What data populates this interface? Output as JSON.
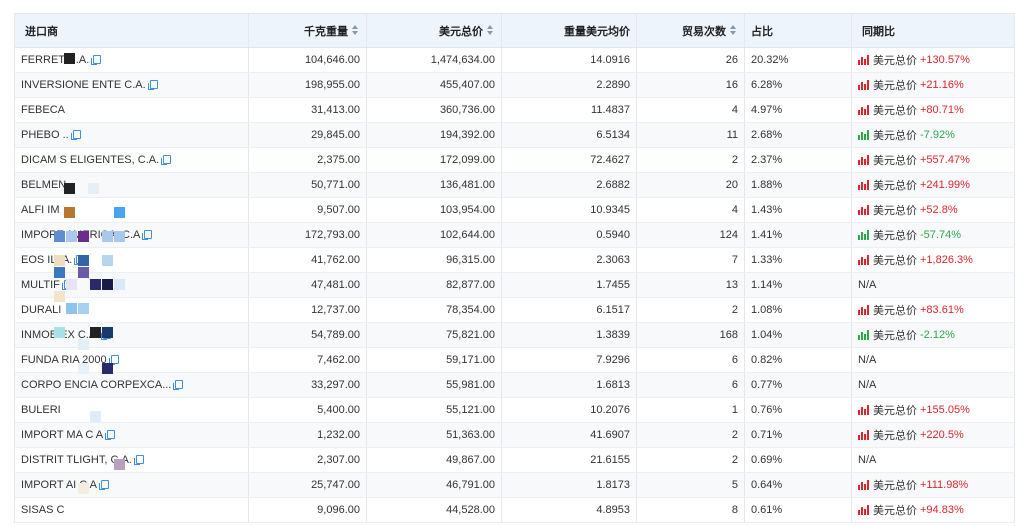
{
  "headers": {
    "importer": "进口商",
    "weight": "千克重量",
    "total_usd": "美元总价",
    "unit_price": "重量美元均价",
    "trades": "贸易次数",
    "share": "占比",
    "yoy": "同期比"
  },
  "colors": {
    "up": "#e0242c",
    "down": "#2ba84a",
    "header_bg": "#eef4fc",
    "copy_icon": "#3d8fe0"
  },
  "rows": [
    {
      "name": "FERRET      C.A.",
      "weight": "104,646.00",
      "total": "1,474,634.00",
      "unit": "14.0916",
      "trades": "26",
      "share": "20.32%",
      "yoy_label": "美元总价",
      "yoy_value": "+130.57%",
      "dir": "up",
      "copy": true
    },
    {
      "name": "INVERSIONE        ENTE C.A.",
      "weight": "198,955.00",
      "total": "455,407.00",
      "unit": "2.2890",
      "trades": "16",
      "share": "6.28%",
      "yoy_label": "美元总价",
      "yoy_value": "+21.16%",
      "dir": "up",
      "copy": true
    },
    {
      "name": "FEBECA",
      "weight": "31,413.00",
      "total": "360,736.00",
      "unit": "11.4837",
      "trades": "4",
      "share": "4.97%",
      "yoy_label": "美元总价",
      "yoy_value": "+80.71%",
      "dir": "up",
      "copy": false
    },
    {
      "name": "PHEBO        ..",
      "weight": "29,845.00",
      "total": "194,392.00",
      "unit": "6.5134",
      "trades": "11",
      "share": "2.68%",
      "yoy_label": "美元总价",
      "yoy_value": "-7.92%",
      "dir": "down",
      "copy": true
    },
    {
      "name": "DICAM S        ELIGENTES, C.A.",
      "weight": "2,375.00",
      "total": "172,099.00",
      "unit": "72.4627",
      "trades": "2",
      "share": "2.37%",
      "yoy_label": "美元总价",
      "yoy_value": "+557.47%",
      "dir": "up",
      "copy": true
    },
    {
      "name": "BELMEN",
      "weight": "50,771.00",
      "total": "136,481.00",
      "unit": "2.6882",
      "trades": "20",
      "share": "1.88%",
      "yoy_label": "美元总价",
      "yoy_value": "+241.99%",
      "dir": "up",
      "copy": false
    },
    {
      "name": "ALFI IM",
      "weight": "9,507.00",
      "total": "103,954.00",
      "unit": "10.9345",
      "trades": "4",
      "share": "1.43%",
      "yoy_label": "美元总价",
      "yoy_value": "+52.8%",
      "dir": "up",
      "copy": false
    },
    {
      "name": "IMPORT                AMERICA, C.A",
      "weight": "172,793.00",
      "total": "102,644.00",
      "unit": "0.5940",
      "trades": "124",
      "share": "1.41%",
      "yoy_label": "美元总价",
      "yoy_value": "-57.74%",
      "dir": "down",
      "copy": true
    },
    {
      "name": "EOS ILI             A.",
      "weight": "41,762.00",
      "total": "96,315.00",
      "unit": "2.3063",
      "trades": "7",
      "share": "1.33%",
      "yoy_label": "美元总价",
      "yoy_value": "+1,826.3%",
      "dir": "up",
      "copy": true
    },
    {
      "name": "MULTIF",
      "weight": "47,481.00",
      "total": "82,877.00",
      "unit": "1.7455",
      "trades": "13",
      "share": "1.14%",
      "yoy_label": "",
      "yoy_value": "N/A",
      "dir": "none",
      "copy": true
    },
    {
      "name": "DURALI",
      "weight": "12,737.00",
      "total": "78,354.00",
      "unit": "6.1517",
      "trades": "2",
      "share": "1.08%",
      "yoy_label": "美元总价",
      "yoy_value": "+83.61%",
      "dir": "up",
      "copy": false
    },
    {
      "name": "INMOB              EX C.A.",
      "weight": "54,789.00",
      "total": "75,821.00",
      "unit": "1.3839",
      "trades": "168",
      "share": "1.04%",
      "yoy_label": "美元总价",
      "yoy_value": "-2.12%",
      "dir": "down",
      "copy": true
    },
    {
      "name": "FUNDA                  RIA 2000",
      "weight": "7,462.00",
      "total": "59,171.00",
      "unit": "7.9296",
      "trades": "6",
      "share": "0.82%",
      "yoy_label": "",
      "yoy_value": "N/A",
      "dir": "none",
      "copy": true
    },
    {
      "name": "CORPO                  ENCIA CORPEXCA...",
      "weight": "33,297.00",
      "total": "55,981.00",
      "unit": "1.6813",
      "trades": "6",
      "share": "0.77%",
      "yoy_label": "",
      "yoy_value": "N/A",
      "dir": "none",
      "copy": true
    },
    {
      "name": "BULERI",
      "weight": "5,400.00",
      "total": "55,121.00",
      "unit": "10.2076",
      "trades": "1",
      "share": "0.76%",
      "yoy_label": "美元总价",
      "yoy_value": "+155.05%",
      "dir": "up",
      "copy": false
    },
    {
      "name": "IMPORT                MA C A",
      "weight": "1,232.00",
      "total": "51,363.00",
      "unit": "41.6907",
      "trades": "2",
      "share": "0.71%",
      "yoy_label": "美元总价",
      "yoy_value": "+220.5%",
      "dir": "up",
      "copy": true
    },
    {
      "name": "DISTRIT                 TLIGHT, C.A.",
      "weight": "2,307.00",
      "total": "49,867.00",
      "unit": "21.6155",
      "trades": "2",
      "share": "0.69%",
      "yoy_label": "",
      "yoy_value": "N/A",
      "dir": "none",
      "copy": true
    },
    {
      "name": "IMPORT            AI C A",
      "weight": "25,747.00",
      "total": "46,791.00",
      "unit": "1.8173",
      "trades": "5",
      "share": "0.64%",
      "yoy_label": "美元总价",
      "yoy_value": "+111.98%",
      "dir": "up",
      "copy": true
    },
    {
      "name": "SISAS C",
      "weight": "9,096.00",
      "total": "44,528.00",
      "unit": "4.8953",
      "trades": "8",
      "share": "0.61%",
      "yoy_label": "美元总价",
      "yoy_value": "+94.83%",
      "dir": "up",
      "copy": false
    }
  ]
}
